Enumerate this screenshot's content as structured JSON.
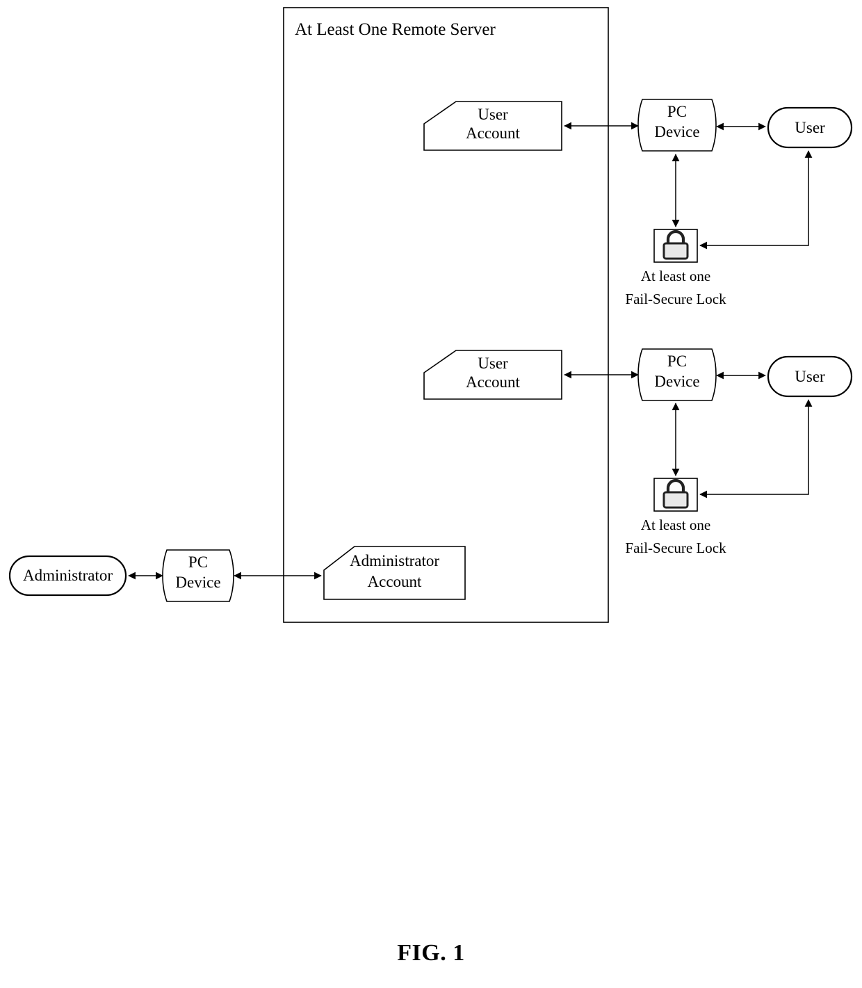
{
  "figure": {
    "caption": "FIG. 1",
    "container": {
      "title": "At Least One Remote Server"
    },
    "stroke_color": "#000000",
    "fill_color": "#ffffff",
    "nodes": [
      {
        "id": "user-account-1",
        "label": "User\nAccount",
        "shape": "clipped-corner-box"
      },
      {
        "id": "pc-device-1",
        "label": "PC\nDevice",
        "shape": "wave-document"
      },
      {
        "id": "user-1",
        "label": "User",
        "shape": "stadium"
      },
      {
        "id": "lock-1",
        "label": "",
        "shape": "icon-box",
        "icon": "padlock-icon"
      },
      {
        "id": "lock-1-caption",
        "label": "At least one\nFail-Secure Lock",
        "shape": "text"
      },
      {
        "id": "user-account-2",
        "label": "User\nAccount",
        "shape": "clipped-corner-box"
      },
      {
        "id": "pc-device-2",
        "label": "PC\nDevice",
        "shape": "wave-document"
      },
      {
        "id": "user-2",
        "label": "User",
        "shape": "stadium"
      },
      {
        "id": "lock-2",
        "label": "",
        "shape": "icon-box",
        "icon": "padlock-icon"
      },
      {
        "id": "lock-2-caption",
        "label": "At least one\nFail-Secure Lock",
        "shape": "text"
      },
      {
        "id": "administrator",
        "label": "Administrator",
        "shape": "stadium"
      },
      {
        "id": "pc-device-admin",
        "label": "PC\nDevice",
        "shape": "wave-document"
      },
      {
        "id": "administrator-account",
        "label": "Administrator\nAccount",
        "shape": "clipped-corner-box"
      }
    ],
    "labels": {
      "user_account": "User\nAccount",
      "user_account_line1": "User",
      "user_account_line2": "Account",
      "pc_device_line1": "PC",
      "pc_device_line2": "Device",
      "user": "User",
      "administrator": "Administrator",
      "administrator_account_line1": "Administrator",
      "administrator_account_line2": "Account",
      "lock_caption_line1": "At least one",
      "lock_caption_line2": "Fail-Secure Lock"
    },
    "connections": [
      {
        "from": "user-account-1",
        "to": "pc-device-1",
        "arrows": "both",
        "orientation": "horizontal"
      },
      {
        "from": "pc-device-1",
        "to": "user-1",
        "arrows": "both",
        "orientation": "horizontal"
      },
      {
        "from": "pc-device-1",
        "to": "lock-1",
        "arrows": "both",
        "orientation": "vertical"
      },
      {
        "from": "user-1",
        "to": "lock-1",
        "arrows": "both",
        "orientation": "elbow"
      },
      {
        "from": "user-account-2",
        "to": "pc-device-2",
        "arrows": "both",
        "orientation": "horizontal"
      },
      {
        "from": "pc-device-2",
        "to": "user-2",
        "arrows": "both",
        "orientation": "horizontal"
      },
      {
        "from": "pc-device-2",
        "to": "lock-2",
        "arrows": "both",
        "orientation": "vertical"
      },
      {
        "from": "user-2",
        "to": "lock-2",
        "arrows": "both",
        "orientation": "elbow"
      },
      {
        "from": "administrator",
        "to": "pc-device-admin",
        "arrows": "both",
        "orientation": "horizontal"
      },
      {
        "from": "pc-device-admin",
        "to": "administrator-account",
        "arrows": "both",
        "orientation": "horizontal"
      }
    ]
  }
}
